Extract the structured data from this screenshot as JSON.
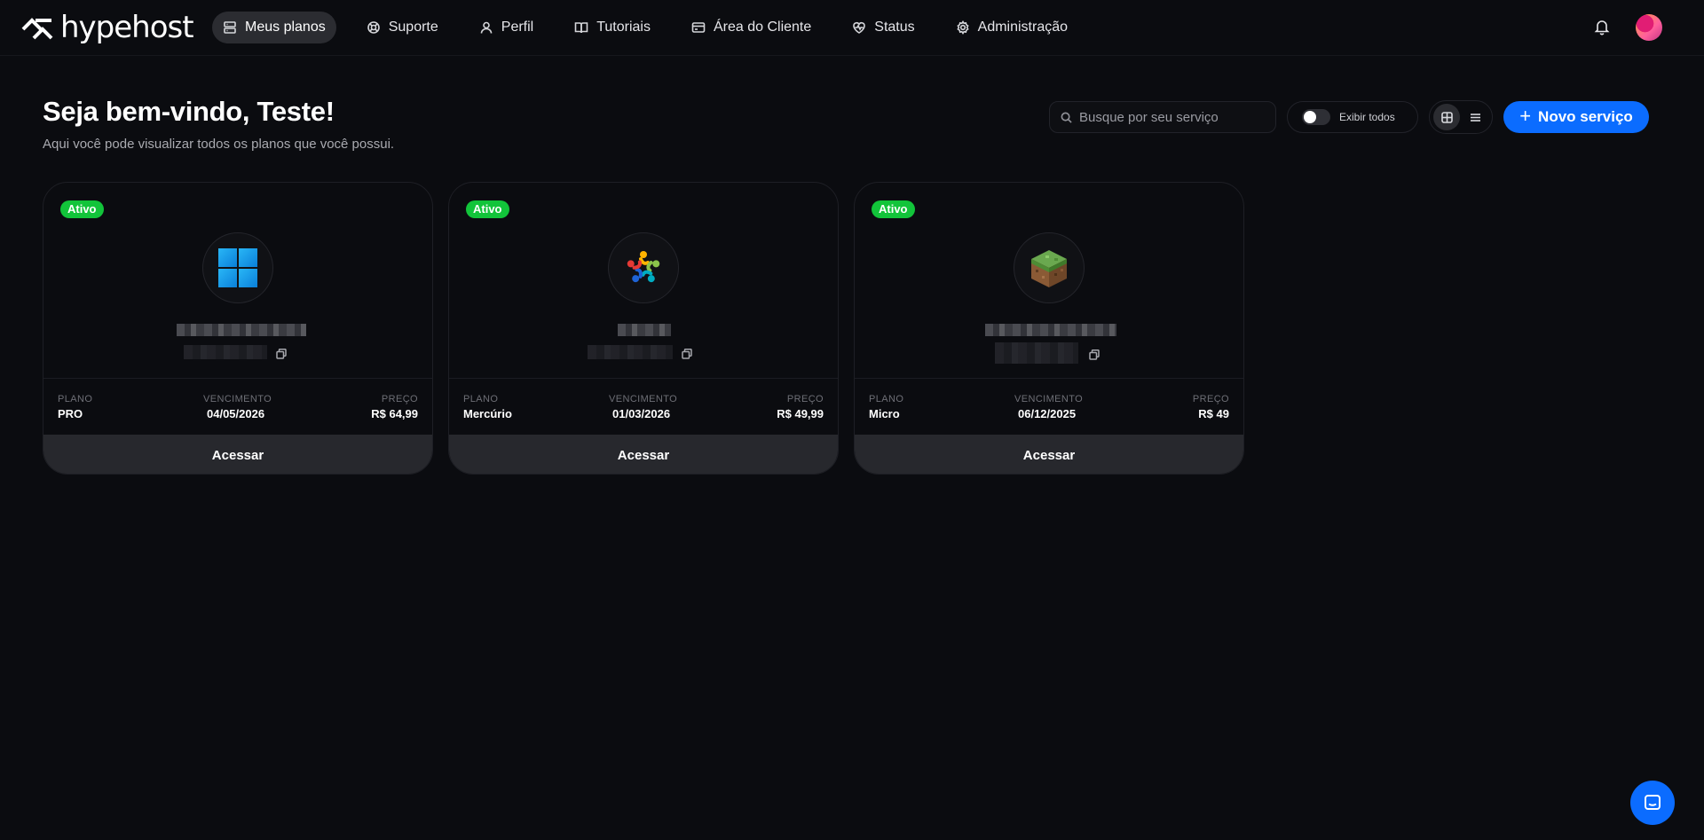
{
  "brand": {
    "name": "hypehost"
  },
  "nav": {
    "items": [
      {
        "label": "Meus planos",
        "icon": "server-icon",
        "active": true
      },
      {
        "label": "Suporte",
        "icon": "lifebuoy-icon",
        "active": false
      },
      {
        "label": "Perfil",
        "icon": "user-icon",
        "active": false
      },
      {
        "label": "Tutoriais",
        "icon": "book-icon",
        "active": false
      },
      {
        "label": "Área do Cliente",
        "icon": "card-icon",
        "active": false
      },
      {
        "label": "Status",
        "icon": "heartbeat-icon",
        "active": false
      },
      {
        "label": "Administração",
        "icon": "gear-icon",
        "active": false
      }
    ]
  },
  "header": {
    "title": "Seja bem-vindo, Teste!",
    "subtitle": "Aqui você pode visualizar todos os planos que você possui."
  },
  "toolbar": {
    "search_placeholder": "Busque por seu serviço",
    "show_all_label": "Exibir todos",
    "new_service_label": "Novo serviço"
  },
  "colors": {
    "accent": "#0b6cff",
    "active_badge": "#12c43a",
    "background": "#0b0c10"
  },
  "cards": [
    {
      "status": "Ativo",
      "icon": "windows-icon",
      "plan_label": "PLANO",
      "plan": "PRO",
      "due_label": "VENCIMENTO",
      "due": "04/05/2026",
      "price_label": "PREÇO",
      "price": "R$ 64,99",
      "action": "Acessar"
    },
    {
      "status": "Ativo",
      "icon": "community-icon",
      "plan_label": "PLANO",
      "plan": "Mercúrio",
      "due_label": "VENCIMENTO",
      "due": "01/03/2026",
      "price_label": "PREÇO",
      "price": "R$ 49,99",
      "action": "Acessar"
    },
    {
      "status": "Ativo",
      "icon": "minecraft-grass-block-icon",
      "plan_label": "PLANO",
      "plan": "Micro",
      "due_label": "VENCIMENTO",
      "due": "06/12/2025",
      "price_label": "PREÇO",
      "price": "R$ 49",
      "action": "Acessar"
    }
  ]
}
